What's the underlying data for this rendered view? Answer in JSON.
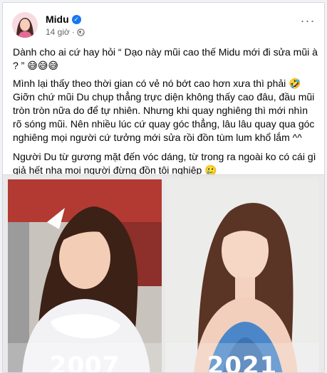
{
  "post": {
    "author_name": "Midu",
    "time": "14 giờ",
    "meta_separator": "·",
    "more_label": "···",
    "paragraphs": [
      "Dành cho ai cứ hay hỏi “ Dạo này mũi cao thế Midu mới đi sửa mũi à ? ” 😅😅😅",
      "Mình lại thấy theo thời gian có vẻ nó bớt cao hơn xưa thì phải 🤣 Giỡn chứ mũi Du chụp thẳng trực diện không thấy cao đâu, đầu mũi tròn tròn nữa do để tự nhiên. Nhưng khi quay nghiêng thì mới nhìn rõ sóng mũi. Nên nhiều lúc cứ quay góc thẳng, lâu lâu quay qua góc nghiêng mọi người cứ tưởng mới sửa rồi đồn tùm lum khổ lắm ^^",
      "Người Du từ gương mặt đến vóc dáng, từ trong ra ngoài ko có cái gì giả hết nha mọi người đừng đồn tội nghiệp 🥲"
    ],
    "photos": [
      {
        "year": "2007",
        "icon": "photo-2007"
      },
      {
        "year": "2021",
        "icon": "photo-2021"
      }
    ]
  },
  "colors": {
    "verified_blue": "#1877f2",
    "meta_gray": "#65676b"
  }
}
